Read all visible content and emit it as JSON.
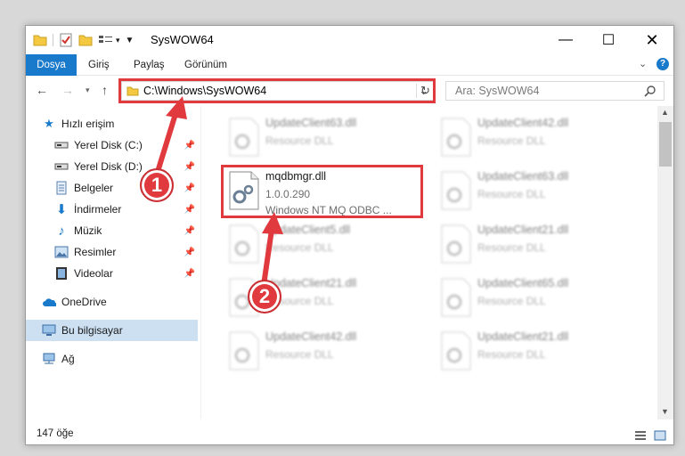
{
  "window": {
    "title": "SysWOW64"
  },
  "ribbon": {
    "tabs": [
      "Dosya",
      "Giriş",
      "Paylaş",
      "Görünüm"
    ]
  },
  "address": {
    "path": "C:\\Windows\\SysWOW64"
  },
  "search": {
    "placeholder": "Ara: SysWOW64"
  },
  "sidebar": {
    "items": [
      {
        "label": "Hızlı erişim",
        "icon": "star-icon"
      },
      {
        "label": "Yerel Disk (C:)",
        "icon": "drive-icon"
      },
      {
        "label": "Yerel Disk (D:)",
        "icon": "drive-icon"
      },
      {
        "label": "Belgeler",
        "icon": "documents-icon"
      },
      {
        "label": "İndirmeler",
        "icon": "download-icon"
      },
      {
        "label": "Müzik",
        "icon": "music-icon"
      },
      {
        "label": "Resimler",
        "icon": "pictures-icon"
      },
      {
        "label": "Videolar",
        "icon": "video-icon"
      },
      {
        "label": "OneDrive",
        "icon": "cloud-icon"
      },
      {
        "label": "Bu bilgisayar",
        "icon": "computer-icon"
      },
      {
        "label": "Ağ",
        "icon": "network-icon"
      }
    ]
  },
  "files": [
    {
      "name": "UpdateClient63.dll",
      "desc": "Resource DLL"
    },
    {
      "name": "UpdateClient42.dll",
      "desc": "Resource DLL"
    },
    {
      "name": "mqdbmgr.dll",
      "version": "1.0.0.290",
      "desc": "Windows NT MQ ODBC ..."
    },
    {
      "name": "UpdateClient63.dll",
      "desc": "Resource DLL"
    },
    {
      "name": "UpdateClient5.dll",
      "desc": "Resource DLL"
    },
    {
      "name": "UpdateClient21.dll",
      "desc": "Resource DLL"
    },
    {
      "name": "UpdateClient21.dll",
      "desc": "Resource DLL"
    },
    {
      "name": "UpdateClient65.dll",
      "desc": "Resource DLL"
    },
    {
      "name": "UpdateClient42.dll",
      "desc": "Resource DLL"
    },
    {
      "name": "UpdateClient21.dll",
      "desc": "Resource DLL"
    }
  ],
  "status": {
    "count": "147 öğe"
  },
  "callouts": [
    "1",
    "2"
  ],
  "colors": {
    "accent": "#1979ca",
    "highlight": "#e0393e",
    "selected": "#cce0f2"
  }
}
